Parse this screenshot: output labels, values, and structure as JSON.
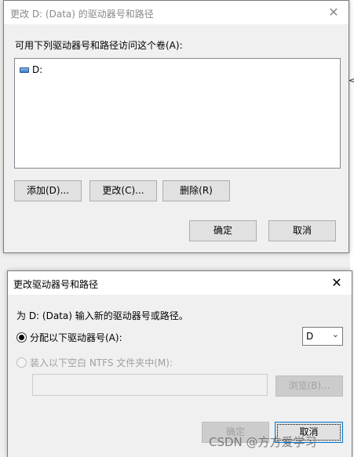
{
  "dialog1": {
    "title": "更改 D: (Data) 的驱动器号和路径",
    "prompt": "可用下列驱动器号和路径访问这个卷(A):",
    "list_items": [
      {
        "label": "D:",
        "icon": "drive-icon"
      }
    ],
    "buttons": {
      "add": "添加(D)...",
      "change": "更改(C)...",
      "remove": "删除(R)",
      "ok": "确定",
      "cancel": "取消"
    }
  },
  "dialog2": {
    "title": "更改驱动器号和路径",
    "description": "为 D: (Data) 输入新的驱动器号或路径。",
    "option_assign": "分配以下驱动器号(A):",
    "option_assign_selected": true,
    "option_mount": "装入以下空白 NTFS 文件夹中(M):",
    "option_mount_enabled": false,
    "drive_letter": "D",
    "path_value": "",
    "buttons": {
      "browse": "浏览(B)...",
      "ok": "确定",
      "cancel": "取消"
    }
  },
  "background": {
    "glyph": "<"
  },
  "watermark": "CSDN @方方爱学习",
  "colors": {
    "focus_border": "#0078d7",
    "title_inactive": "#8a8a8a",
    "disabled_text": "#a0a0a0"
  }
}
